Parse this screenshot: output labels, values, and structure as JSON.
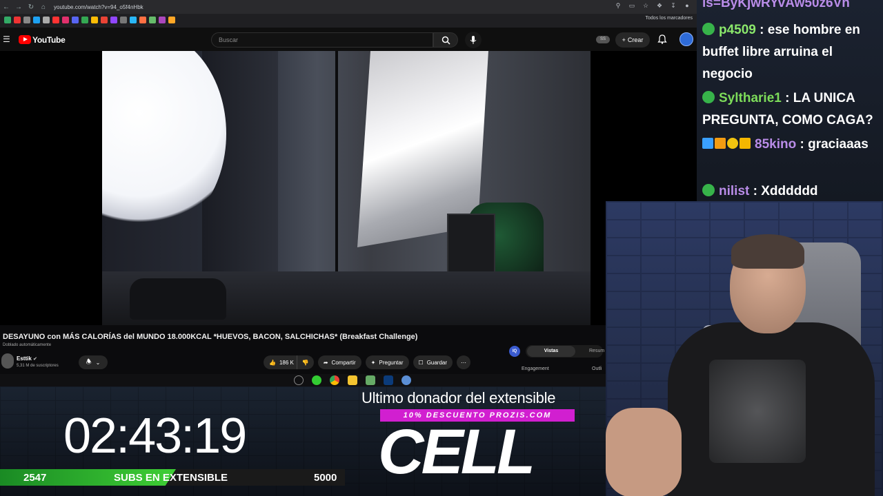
{
  "browser": {
    "url": "youtube.com/watch?v=94_o5f4nHbk",
    "bookmarks_folder": "Todos los marcadores"
  },
  "youtube": {
    "logo_text": "YouTube",
    "search_placeholder": "Buscar",
    "hd_badge": "SS",
    "create_label": "Crear"
  },
  "video": {
    "title": "DESAYUNO con MÁS CALORÍAS del MUNDO 18.000KCAL *HUEVOS, BACON, SALCHICHAS* (Breakfast Challenge)",
    "dub_label": "Doblado automáticamente",
    "channel_name": "Esttik",
    "channel_subs": "5,31 M de suscriptores",
    "likes": "186 K",
    "share_label": "Compartir",
    "ask_label": "Preguntar",
    "save_label": "Guardar"
  },
  "analytics": {
    "badge": "IQ",
    "tab_active": "Vistas",
    "tab_other": "Resum",
    "engagement_label": "Engagement",
    "outlier_label": "Outli"
  },
  "overlay": {
    "timer": "02:43:19",
    "subs_current": "2547",
    "subs_label": "SUBS EN EXTENSIBLE",
    "subs_goal": "5000",
    "subs_progress": 0.509,
    "donor_heading": "Ultimo donador del extensible",
    "promo": "10% DESCUENTO PROZIS.COM",
    "donor_name": "CELL"
  },
  "chat": {
    "top_fragment": "is=ByKjwRYvAw50z6Vh",
    "messages": [
      {
        "user": "p4509",
        "text": ": ese hombre en buffet libre arruina el negocio"
      },
      {
        "user": "Syltharie1",
        "text": ": LA UNICA PREGUNTA, COMO CAGA?"
      },
      {
        "user": "85kino",
        "text": ": graciaaas"
      },
      {
        "user": "nilist",
        "text": ": Xdddddd"
      }
    ]
  },
  "colors": {
    "youtube_red": "#ff0000",
    "promo_magenta": "#d11fd0",
    "progress_green": "#3fcf35",
    "chat_badge_green": "#37b34a"
  }
}
